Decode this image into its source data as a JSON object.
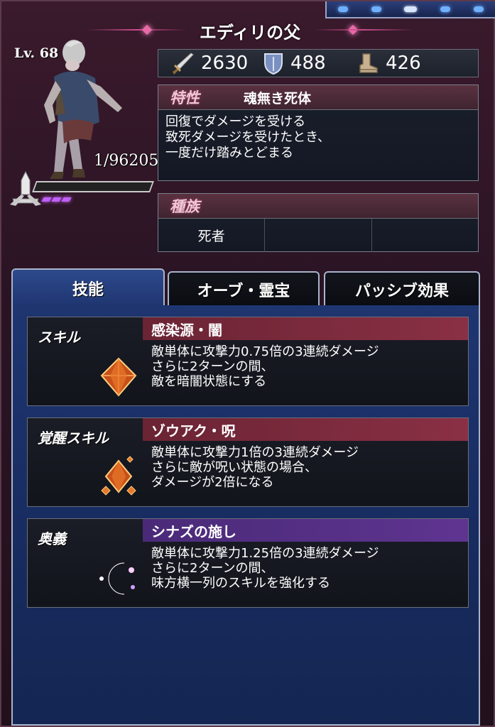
{
  "unit": {
    "name": "エディリの父",
    "level": "Lv. 68",
    "hp": "1/96205"
  },
  "stats": {
    "attack": "2630",
    "defense": "488",
    "speed": "426"
  },
  "trait": {
    "label": "特性",
    "name": "魂無き死体",
    "description_lines": [
      "回復でダメージを受ける",
      "致死ダメージを受けたとき、",
      "一度だけ踏みとどまる"
    ]
  },
  "race": {
    "label": "種族",
    "values": [
      "死者",
      "",
      ""
    ]
  },
  "tabs": {
    "skills": "技能",
    "orbs": "オーブ・霊宝",
    "passive": "パッシブ効果"
  },
  "skills": [
    {
      "type": "スキル",
      "name": "感染源・闇",
      "bar_color": "#8a3044",
      "icon": "orange-crystal-icon",
      "lines": [
        "敵単体に攻撃力0.75倍の3連続ダメージ",
        "さらに2ターンの間、",
        "敵を暗闇状態にする"
      ]
    },
    {
      "type": "覚醒スキル",
      "name": "ゾウアク・呪",
      "bar_color": "#8a3044",
      "icon": "orange-crystal-cluster-icon",
      "lines": [
        "敵単体に攻撃力1倍の3連続ダメージ",
        "さらに敵が呪い状態の場合、",
        "ダメージが2倍になる"
      ]
    },
    {
      "type": "奥義",
      "name": "シナズの施し",
      "bar_color": "#5e3490",
      "icon": "rainbow-crescent-icon",
      "lines": [
        "敵単体に攻撃力1.25倍の3連続ダメージ",
        "さらに2ターンの間、",
        "味方横一列のスキルを強化する"
      ]
    }
  ],
  "colors": {
    "content_blue": "#1e3570",
    "skill_bar_red": "#8a3044",
    "ougi_bar_purple": "#5e3490",
    "accent_pink": "#e86aa8"
  }
}
